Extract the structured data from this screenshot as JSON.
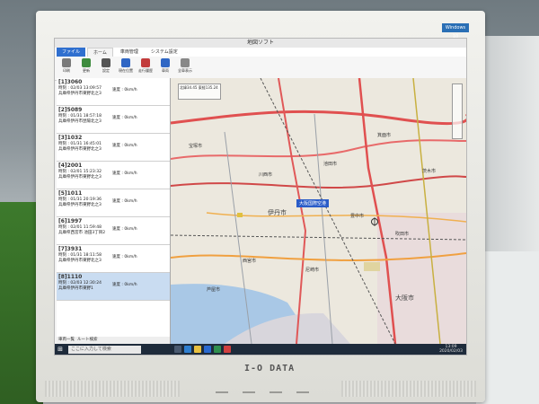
{
  "window": {
    "title": "地図ソフト"
  },
  "ribbon": {
    "tabs": [
      "ファイル",
      "ホーム",
      "車両管理",
      "システム設定"
    ],
    "buttons": [
      {
        "label": "印刷",
        "icon": "printer-icon"
      },
      {
        "label": "更新",
        "icon": "refresh-icon"
      },
      {
        "label": "設定",
        "icon": "tools-icon"
      },
      {
        "label": "現在位置",
        "icon": "location-icon"
      },
      {
        "label": "走行履歴",
        "icon": "history-icon"
      },
      {
        "label": "車両",
        "icon": "car-icon"
      },
      {
        "label": "全車表示",
        "icon": "all-vehicles-icon"
      }
    ],
    "groups": [
      "表示",
      "車両情報",
      "設定"
    ]
  },
  "vehicles": [
    {
      "id": "[1]3060",
      "time": "時刻 : 02/03 13:09:57",
      "speed": "速度 : 0km/h",
      "location": "兵庫県伊丹市東野北之3"
    },
    {
      "id": "[2]5089",
      "time": "時刻 : 01/31 18:57:18",
      "speed": "速度 : 0km/h",
      "location": "兵庫県伊丹市昆陽北之3"
    },
    {
      "id": "[3]1032",
      "time": "時刻 : 01/31 16:45:01",
      "speed": "速度 : 0km/h",
      "location": "兵庫県伊丹市東野北之3"
    },
    {
      "id": "[4]2001",
      "time": "時刻 : 02/01 15:23:32",
      "speed": "速度 : 0km/h",
      "location": "兵庫県伊丹市東野北之3"
    },
    {
      "id": "[5]1011",
      "time": "時刻 : 01/31 20:19:36",
      "speed": "速度 : 0km/h",
      "location": "兵庫県伊丹市東野北之3"
    },
    {
      "id": "[6]1997",
      "time": "時刻 : 02/01 11:59:48",
      "speed": "速度 : 0km/h",
      "location": "兵庫県西宮市 池田3丁目2"
    },
    {
      "id": "[7]3931",
      "time": "時刻 : 01/31 18:11:58",
      "speed": "速度 : 0km/h",
      "location": "兵庫県伊丹市東野北之3"
    },
    {
      "id": "[8]1110",
      "time": "時刻 : 02/03 12:30:24",
      "speed": "速度 : 0km/h",
      "location": "兵庫県伊丹市東野1"
    }
  ],
  "panel_footer": {
    "tab1": "車両一覧",
    "tab2": "ルート検索"
  },
  "map": {
    "labels": [
      "伊丹市",
      "宝塚市",
      "川西市",
      "池田市",
      "豊中市",
      "吹田市",
      "尼崎市",
      "西宮市",
      "芦屋市",
      "大阪市",
      "箕面市",
      "茨木市"
    ],
    "highlight_tag": "大阪国際空港",
    "coords": "北緯34.45 東経135.24"
  },
  "taskbar": {
    "search_placeholder": "ここに入力して検索",
    "time": "13:09",
    "date": "2020/02/03"
  },
  "monitor": {
    "brand": "I-O DATA",
    "badge": "Windows 10"
  }
}
